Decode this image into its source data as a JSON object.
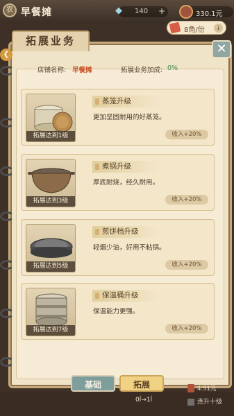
{
  "hud": {
    "stall_badge": "农",
    "stall_name": "早餐摊",
    "gems": "140",
    "gem_plus": "+",
    "money": "330.1元"
  },
  "price_tag": {
    "value": "8角/份",
    "arrow": "↓"
  },
  "panel": {
    "title": "拓展业务",
    "close": "✕",
    "shop_label": "店铺名称:",
    "shop_name": "早餐摊",
    "bonus_label": "拓展业务加成:",
    "bonus_value": "0%"
  },
  "cards": [
    {
      "title": "蒸笼升级",
      "desc": "更加坚固耐用的好蒸笼。",
      "level": "拓展达到1级",
      "income": "收入+20%",
      "icon": "steamer-icon"
    },
    {
      "title": "煮锅升级",
      "desc": "厚底耐烧，经久耐用。",
      "level": "拓展达到3级",
      "income": "收入+20%",
      "icon": "pot-icon"
    },
    {
      "title": "煎饼档升级",
      "desc": "轻烟少油，好用不粘锅。",
      "level": "拓展达到5级",
      "income": "收入+20%",
      "icon": "griddle-icon"
    },
    {
      "title": "保温桶升级",
      "desc": "保温能力更强。",
      "level": "拓展达到7级",
      "income": "收入+20%",
      "icon": "bucket-icon"
    }
  ],
  "tabs": {
    "basic": "基础",
    "expand": "拓展"
  },
  "footer": {
    "coin_value": "4.51元",
    "level_change": "0ĺ→1ĺ",
    "ten_upgrade": "连升十级"
  },
  "colors": {
    "accent_orange": "#c9552b",
    "bonus_green": "#3e8a4b",
    "tab_active": "#f1d183",
    "tab_inactive": "#7e9e9b"
  }
}
